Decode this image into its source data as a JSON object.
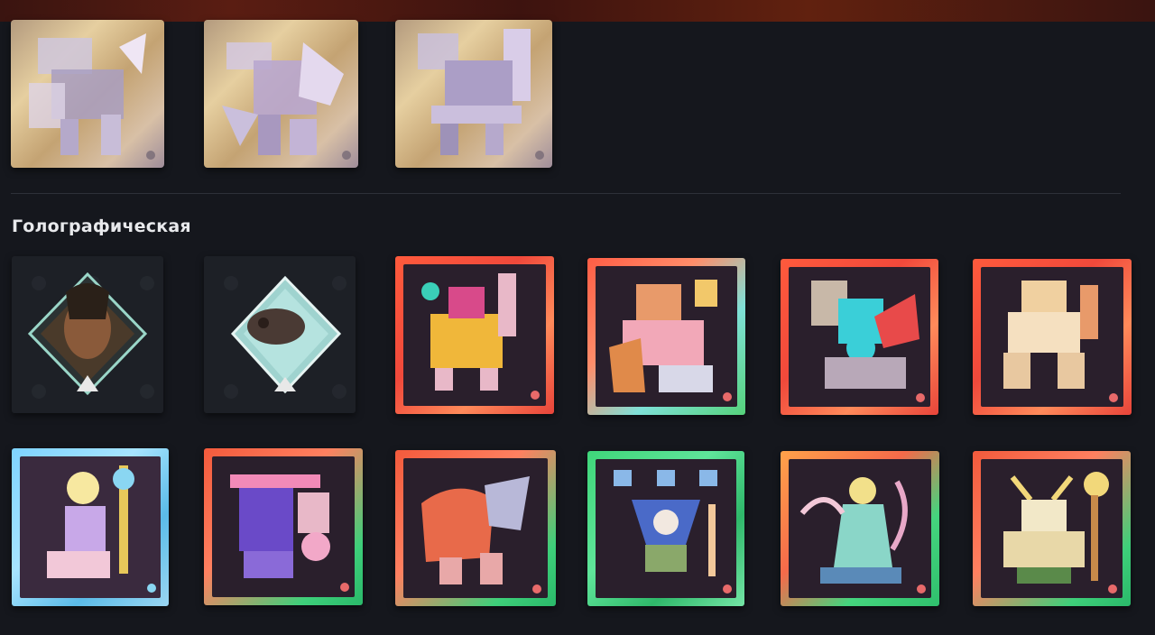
{
  "section": {
    "title": "Голографическая"
  },
  "top_row_cards": [
    {
      "name": "sticker-metal-1",
      "kind": "metallic"
    },
    {
      "name": "sticker-metal-2",
      "kind": "metallic"
    },
    {
      "name": "sticker-metal-3",
      "kind": "metallic"
    }
  ],
  "colors": {
    "background": "#15171d",
    "divider": "#2d3039",
    "title": "#e8e9ec",
    "frame_red": "#f0493b",
    "frame_green": "#3fd67a",
    "frame_blue": "#7ed3ff"
  },
  "icons": [
    "hero-figure-icon",
    "diamond-badge-icon",
    "corner-logo-icon"
  ]
}
